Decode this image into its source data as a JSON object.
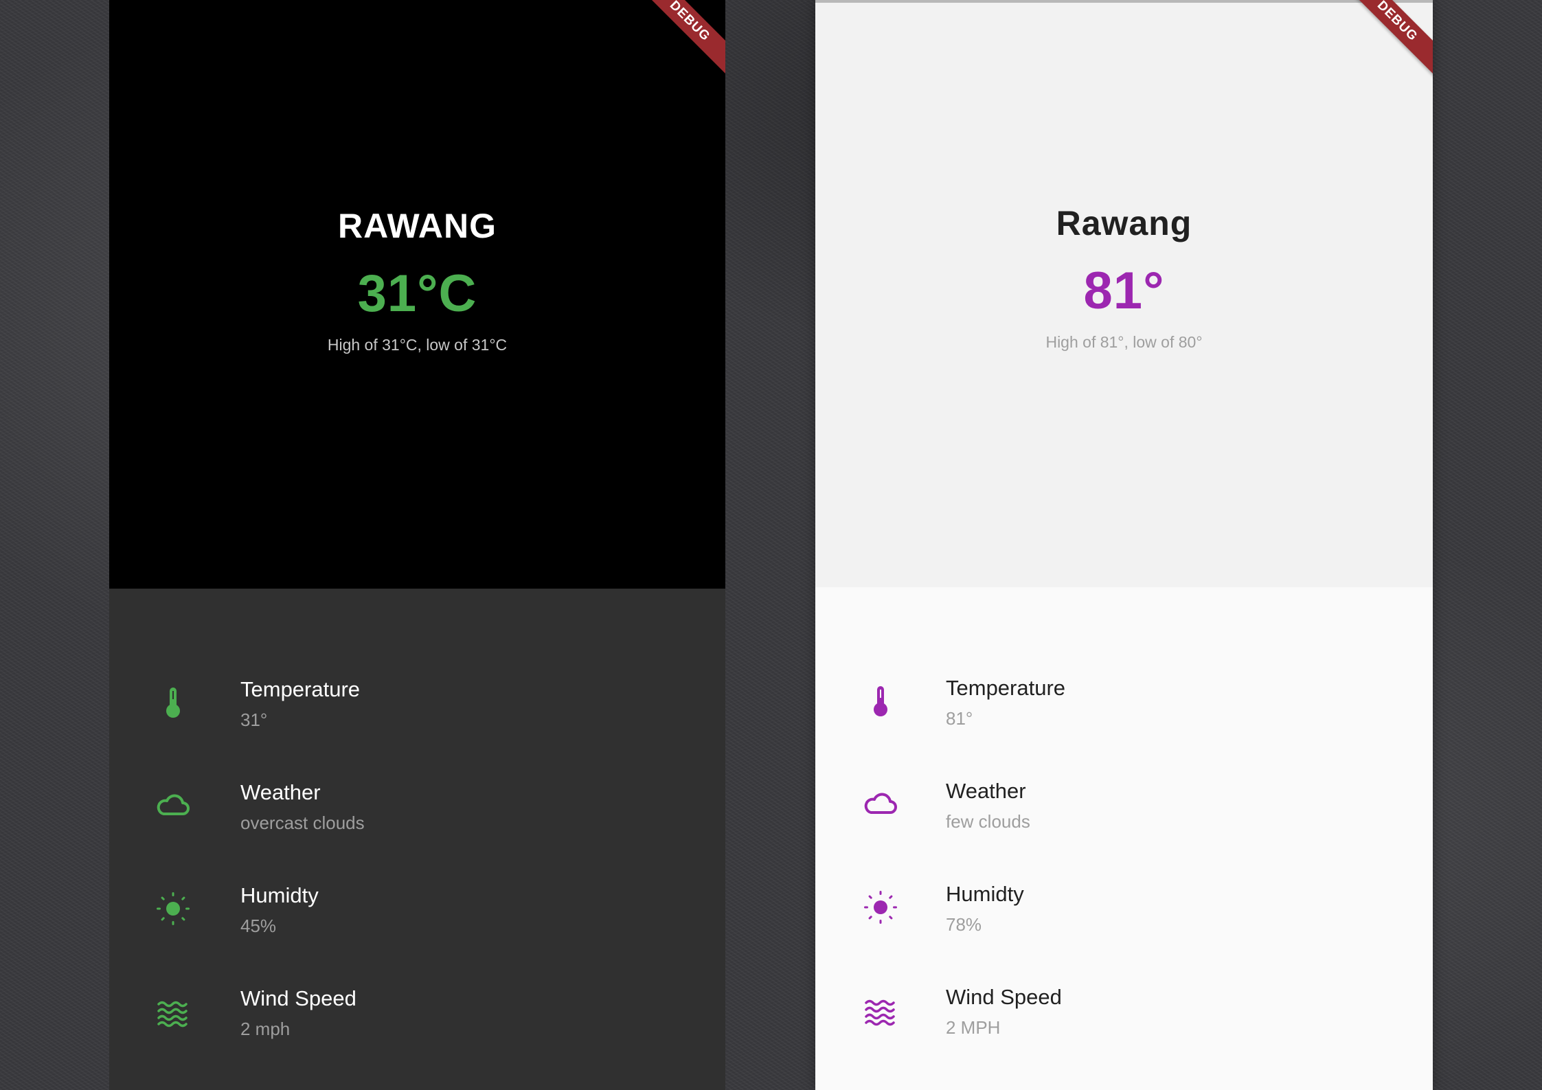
{
  "left_app": {
    "theme": "dark",
    "accent_color": "#4caf50",
    "debug_banner": "DEBUG",
    "city": "RAWANG",
    "temperature": "31°C",
    "high_low": "High of 31°C, low of 31°C",
    "details": [
      {
        "icon": "thermometer-icon",
        "title": "Temperature",
        "value": "31°"
      },
      {
        "icon": "cloud-icon",
        "title": "Weather",
        "value": "overcast clouds"
      },
      {
        "icon": "sun-icon",
        "title": "Humidty",
        "value": "45%"
      },
      {
        "icon": "waves-icon",
        "title": "Wind Speed",
        "value": "2 mph"
      }
    ]
  },
  "right_app": {
    "theme": "light",
    "accent_color": "#9c27b0",
    "debug_banner": "DEBUG",
    "city": "Rawang",
    "temperature": "81°",
    "high_low": "High of 81°, low of 80°",
    "details": [
      {
        "icon": "thermometer-icon",
        "title": "Temperature",
        "value": "81°"
      },
      {
        "icon": "cloud-icon",
        "title": "Weather",
        "value": "few clouds"
      },
      {
        "icon": "sun-icon",
        "title": "Humidty",
        "value": "78%"
      },
      {
        "icon": "waves-icon",
        "title": "Wind Speed",
        "value": "2 MPH"
      }
    ]
  }
}
